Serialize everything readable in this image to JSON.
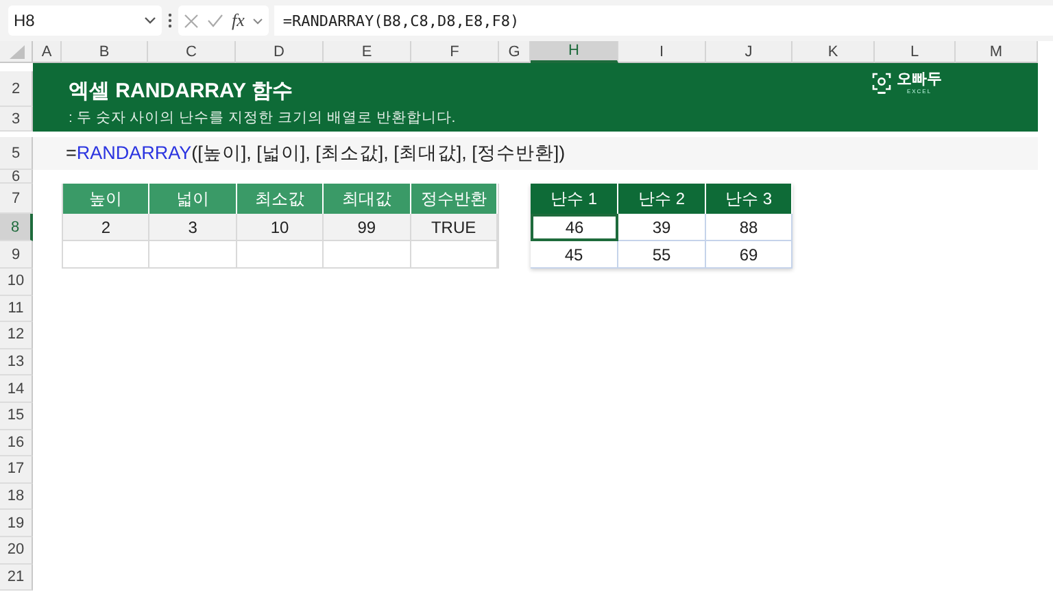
{
  "formula_bar": {
    "name_box": "H8",
    "fx": "fx",
    "formula": "=RANDARRAY(B8,C8,D8,E8,F8)"
  },
  "columns": [
    {
      "label": "A",
      "selected": false
    },
    {
      "label": "B",
      "selected": false
    },
    {
      "label": "C",
      "selected": false
    },
    {
      "label": "D",
      "selected": false
    },
    {
      "label": "E",
      "selected": false
    },
    {
      "label": "F",
      "selected": false
    },
    {
      "label": "G",
      "selected": false
    },
    {
      "label": "H",
      "selected": true
    },
    {
      "label": "I",
      "selected": false
    },
    {
      "label": "J",
      "selected": false
    },
    {
      "label": "K",
      "selected": false
    },
    {
      "label": "L",
      "selected": false
    },
    {
      "label": "M",
      "selected": false
    }
  ],
  "rows": [
    {
      "label": "2",
      "selected": false
    },
    {
      "label": "3",
      "selected": false
    },
    {
      "label": "5",
      "selected": false
    },
    {
      "label": "6",
      "selected": false
    },
    {
      "label": "7",
      "selected": false
    },
    {
      "label": "8",
      "selected": true
    },
    {
      "label": "9",
      "selected": false
    },
    {
      "label": "10",
      "selected": false
    },
    {
      "label": "11",
      "selected": false
    },
    {
      "label": "12",
      "selected": false
    },
    {
      "label": "13",
      "selected": false
    },
    {
      "label": "14",
      "selected": false
    },
    {
      "label": "15",
      "selected": false
    },
    {
      "label": "16",
      "selected": false
    },
    {
      "label": "17",
      "selected": false
    },
    {
      "label": "18",
      "selected": false
    },
    {
      "label": "19",
      "selected": false
    },
    {
      "label": "20",
      "selected": false
    },
    {
      "label": "21",
      "selected": false
    }
  ],
  "banner": {
    "title": "엑셀 RANDARRAY 함수",
    "subtitle": ": 두 숫자 사이의 난수를 지정한 크기의 배열로 반환합니다.",
    "logo": {
      "name": "오빠두",
      "tagline": "EXCEL"
    }
  },
  "syntax": {
    "prefix": "=",
    "function": "RANDARRAY",
    "arguments": "([높이], [넓이], [최소값], [최대값], [정수반환])"
  },
  "input_table": {
    "columns": [
      "높이",
      "넓이",
      "최소값",
      "최대값",
      "정수반환"
    ],
    "rows": [
      [
        "2",
        "3",
        "10",
        "99",
        "TRUE"
      ],
      [
        "",
        "",
        "",
        "",
        ""
      ]
    ]
  },
  "output_table": {
    "columns": [
      "난수 1",
      "난수 2",
      "난수 3"
    ],
    "rows": [
      [
        {
          "value": "46",
          "selected": true
        },
        {
          "value": "39",
          "selected": false
        },
        {
          "value": "88",
          "selected": false
        }
      ],
      [
        {
          "value": "45",
          "selected": false
        },
        {
          "value": "55",
          "selected": false
        },
        {
          "value": "69",
          "selected": false
        }
      ]
    ]
  }
}
